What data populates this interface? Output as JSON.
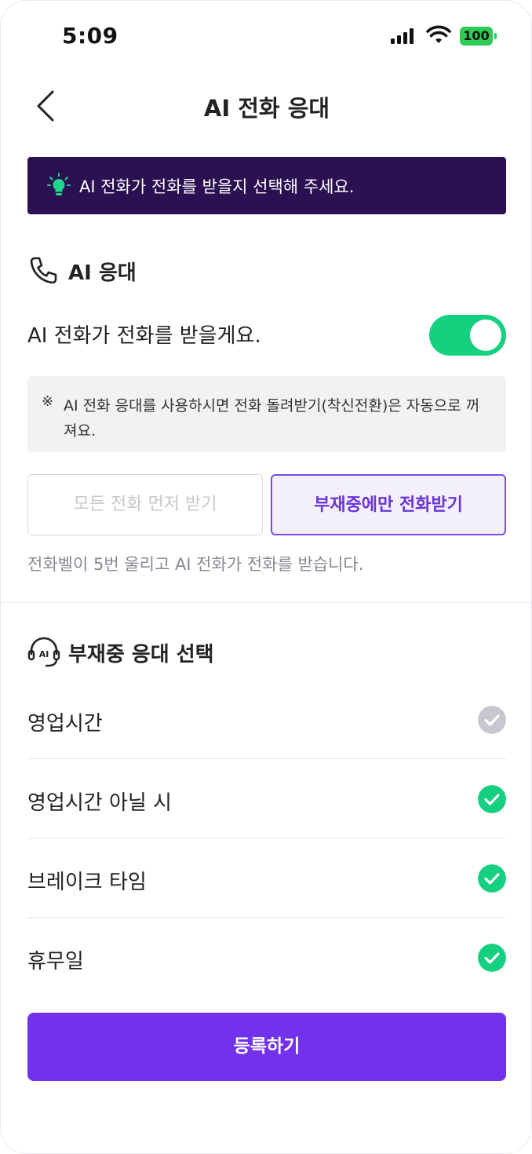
{
  "status_bar": {
    "time": "5:09",
    "battery": "100"
  },
  "header": {
    "title": "AI 전화 응대"
  },
  "notice": {
    "text": "AI 전화가 전화를 받을지 선택해 주세요."
  },
  "ai_response": {
    "section_title": "AI 응대",
    "toggle_label": "AI 전화가 전화를 받을게요.",
    "toggle_on": true,
    "info_mark": "※",
    "info_text": "AI 전화 응대를 사용하시면 전화 돌려받기(착신전환)은 자동으로 꺼져요.",
    "options": [
      "모든 전화 먼저 받기",
      "부재중에만 전화받기"
    ],
    "selected_option": "부재중에만 전화받기",
    "description": "전화벨이 5번 울리고 AI 전화가 전화를 받습니다."
  },
  "absence": {
    "section_title": "부재중 응대 선택",
    "icon_text": "AI",
    "items": [
      {
        "label": "영업시간",
        "checked": false
      },
      {
        "label": "영업시간 아닐 시",
        "checked": true
      },
      {
        "label": "브레이크 타임",
        "checked": true
      },
      {
        "label": "휴무일",
        "checked": true
      }
    ]
  },
  "submit": {
    "label": "등록하기"
  },
  "colors": {
    "notice_bg": "#2b1052",
    "toggle_on": "#14d07f",
    "accent_purple": "#7231ea",
    "check_on": "#14d07f",
    "check_off": "#c9c6cf"
  }
}
